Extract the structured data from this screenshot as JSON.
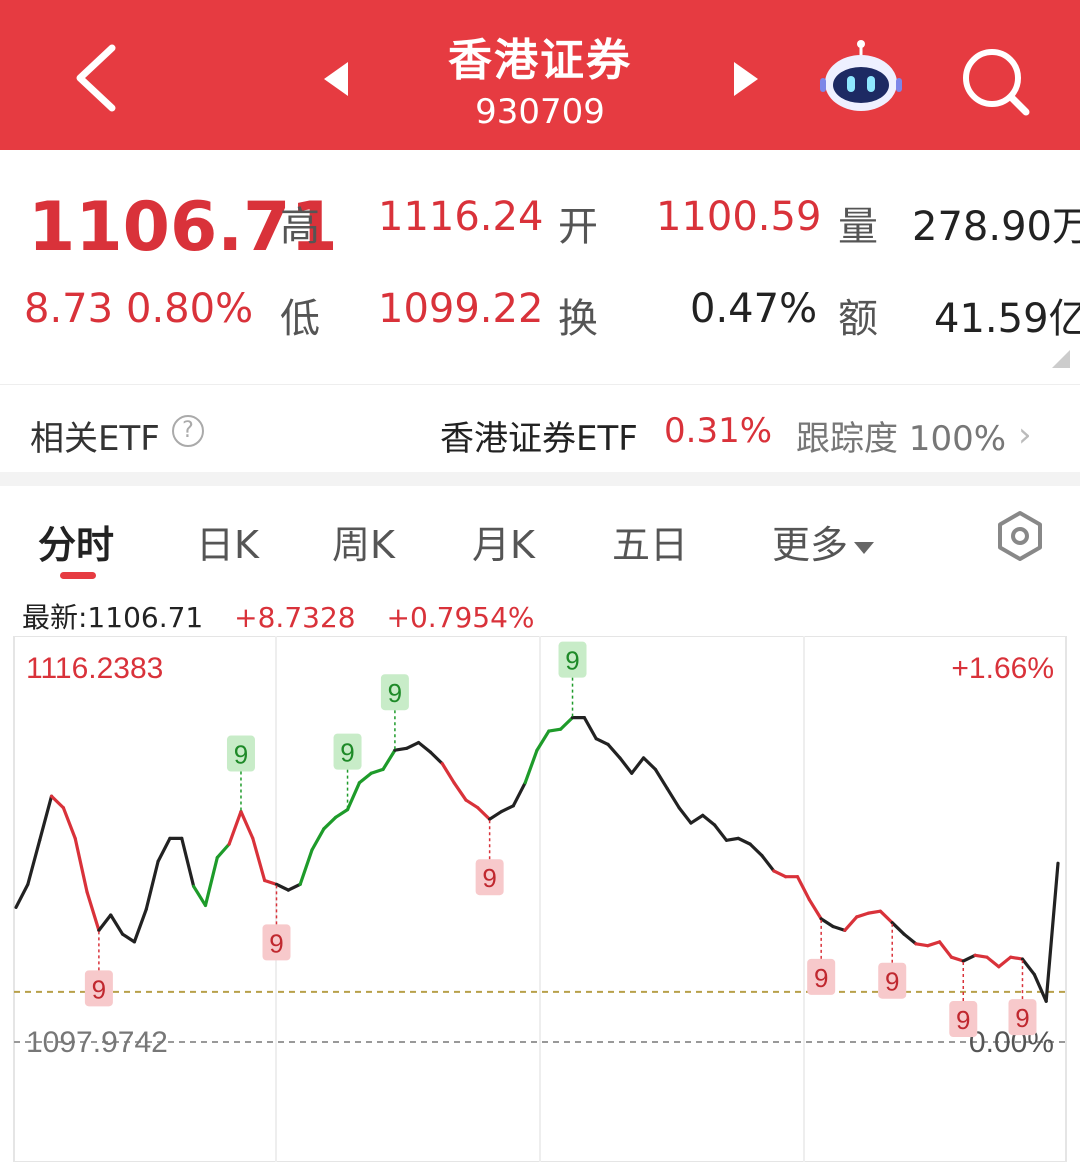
{
  "header": {
    "title": "香港证券",
    "code": "930709"
  },
  "quote": {
    "price": "1106.71",
    "change": "8.73",
    "change_pct": "0.80%",
    "high_label": "高",
    "high": "1116.24",
    "low_label": "低",
    "low": "1099.22",
    "open_label": "开",
    "open": "1100.59",
    "turnover_label": "换",
    "turnover": "0.47%",
    "volume_label": "量",
    "volume": "278.90万",
    "amount_label": "额",
    "amount": "41.59亿"
  },
  "etf": {
    "label": "相关ETF",
    "help": "?",
    "name": "香港证券ETF",
    "pct": "0.31%",
    "tracking": "跟踪度 100%"
  },
  "tabs": [
    "分时",
    "日K",
    "周K",
    "月K",
    "五日",
    "更多"
  ],
  "latest": {
    "label": "最新:1106.71",
    "change": "+8.7328",
    "change_pct": "+0.7954%"
  },
  "colors": {
    "up": "#d9323a",
    "down_green": "#1e9b2a",
    "header_bg": "#e63b41"
  },
  "chart_data": {
    "type": "line",
    "y_top_label": "1116.2383",
    "y_bottom_label": "1097.9742",
    "pct_top_label": "+1.66%",
    "pct_bottom_label": "0.00%",
    "ylim": [
      1097.9742,
      1116.2383
    ],
    "prev_close": 1097.9742,
    "series": [
      {
        "values": [
          1105.0,
          1106.2,
          1108.5,
          1110.8,
          1110.2,
          1108.6,
          1105.8,
          1103.8,
          1104.6,
          1103.6,
          1103.2,
          1104.9,
          1107.4,
          1108.6,
          1108.6,
          1106.1,
          1105.1,
          1107.6,
          1108.3,
          1110.0,
          1108.6,
          1106.4,
          1106.2,
          1105.9,
          1106.2,
          1108.0,
          1109.1,
          1109.7,
          1110.1,
          1111.5,
          1112.0,
          1112.2,
          1113.2,
          1113.3,
          1113.6,
          1113.1,
          1112.5,
          1111.5,
          1110.6,
          1110.2,
          1109.6,
          1110.0,
          1110.3,
          1111.5,
          1113.2,
          1114.2,
          1114.3,
          1114.9,
          1114.9,
          1113.8,
          1113.5,
          1112.8,
          1112.0,
          1112.8,
          1112.2,
          1111.2,
          1110.2,
          1109.4,
          1109.8,
          1109.3,
          1108.5,
          1108.6,
          1108.3,
          1107.7,
          1106.9,
          1106.6,
          1106.6,
          1105.4,
          1104.4,
          1104.0,
          1103.8,
          1104.5,
          1104.7,
          1104.8,
          1104.2,
          1103.6,
          1103.1,
          1103.0,
          1103.2,
          1102.4,
          1102.2,
          1102.5,
          1102.4,
          1101.9,
          1102.4,
          1102.3,
          1101.5,
          1100.1,
          1107.3
        ]
      }
    ],
    "markers": [
      {
        "kind": "low-9",
        "label": "9",
        "index": 7
      },
      {
        "kind": "high-9",
        "label": "9",
        "index": 19
      },
      {
        "kind": "low-9",
        "label": "9",
        "index": 22
      },
      {
        "kind": "high-9",
        "label": "9",
        "index": 28
      },
      {
        "kind": "high-9",
        "label": "9",
        "index": 32
      },
      {
        "kind": "low-9",
        "label": "9",
        "index": 40
      },
      {
        "kind": "high-9",
        "label": "9",
        "index": 47
      },
      {
        "kind": "low-9",
        "label": "9",
        "index": 68
      },
      {
        "kind": "low-9",
        "label": "9",
        "index": 74
      },
      {
        "kind": "low-9",
        "label": "9",
        "index": 80
      },
      {
        "kind": "low-9",
        "label": "9",
        "index": 85
      }
    ]
  }
}
